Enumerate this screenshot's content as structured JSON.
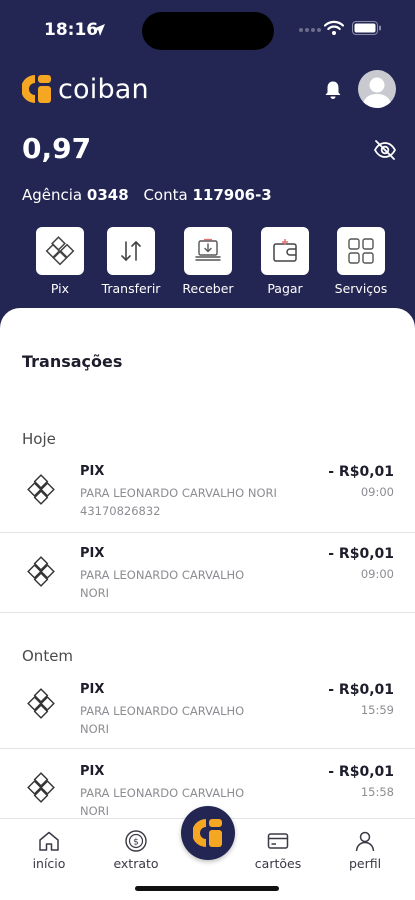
{
  "status_bar": {
    "time": "18:16"
  },
  "header": {
    "brand_name": "coiban",
    "balance": "0,97",
    "agency_label": "Agência",
    "agency_number": "0348",
    "account_label": "Conta",
    "account_number": "117906-3"
  },
  "actions": [
    {
      "label": "Pix",
      "icon": "pix-icon"
    },
    {
      "label": "Transferir",
      "icon": "transfer-arrows-icon"
    },
    {
      "label": "Receber",
      "icon": "receive-icon"
    },
    {
      "label": "Pagar",
      "icon": "wallet-icon"
    },
    {
      "label": "Serviços",
      "icon": "grid-icon"
    }
  ],
  "transactions_section": {
    "title": "Transações",
    "groups": [
      {
        "day": "Hoje",
        "items": [
          {
            "title": "PIX",
            "desc_line1": "PARA LEONARDO CARVALHO NORI",
            "desc_line2": "43170826832",
            "amount": "- R$0,01",
            "time": "09:00"
          },
          {
            "title": "PIX",
            "desc_line1": "PARA LEONARDO CARVALHO",
            "desc_line2": "NORI",
            "amount": "- R$0,01",
            "time": "09:00"
          }
        ]
      },
      {
        "day": "Ontem",
        "items": [
          {
            "title": "PIX",
            "desc_line1": "PARA LEONARDO CARVALHO",
            "desc_line2": "NORI",
            "amount": "- R$0,01",
            "time": "15:59"
          },
          {
            "title": "PIX",
            "desc_line1": "PARA LEONARDO CARVALHO",
            "desc_line2": "NORI",
            "amount": "- R$0,01",
            "time": "15:58"
          }
        ]
      }
    ]
  },
  "bottom_nav": [
    {
      "label": "início",
      "icon": "home-icon"
    },
    {
      "label": "extrato",
      "icon": "statement-coin-icon"
    },
    {
      "label": "cartões",
      "icon": "card-icon"
    },
    {
      "label": "perfil",
      "icon": "person-icon"
    }
  ],
  "colors": {
    "primary_navy": "#232652",
    "brand_orange": "#f5a623",
    "white": "#ffffff"
  }
}
